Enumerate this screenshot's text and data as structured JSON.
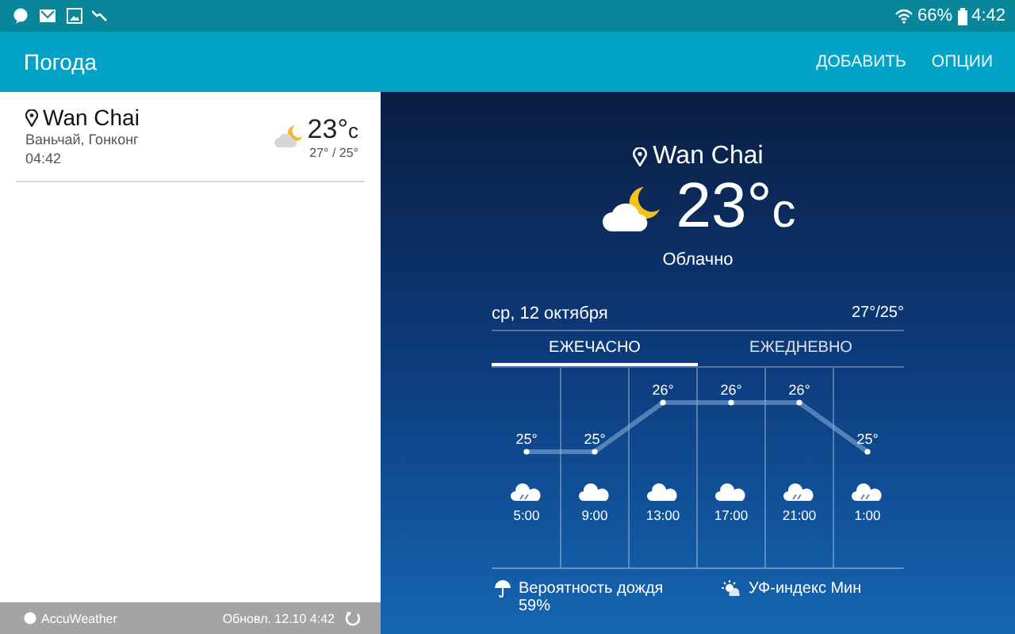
{
  "status_bar": {
    "battery": "66%",
    "time": "4:42"
  },
  "app_bar": {
    "title": "Погода",
    "actions": [
      "ДОБАВИТЬ",
      "ОПЦИИ"
    ]
  },
  "locations": [
    {
      "name": "Wan Chai",
      "subtitle": "Ваньчай, Гонконг",
      "time": "04:42",
      "temp": "23°",
      "unit": "c",
      "range": "27° / 25°",
      "selected": true
    }
  ],
  "footer": {
    "brand": "AccuWeather",
    "updated": "Обновл. 12.10 4:42"
  },
  "current": {
    "city": "Wan Chai",
    "temp": "23°",
    "unit": "c",
    "condition": "Облачно",
    "date": "ср, 12 октября",
    "range": "27°/25°"
  },
  "tabs": [
    {
      "label": "ЕЖЕЧАСНО",
      "selected": true
    },
    {
      "label": "ЕЖЕДНЕВНО",
      "selected": false
    }
  ],
  "hourly": {
    "chart_data": {
      "type": "line",
      "categories": [
        "5:00",
        "9:00",
        "13:00",
        "17:00",
        "21:00",
        "1:00"
      ],
      "series": [
        {
          "values": [
            25,
            25,
            26,
            26,
            26,
            25
          ],
          "marker": "circle",
          "value_labels": [
            "25°",
            "25°",
            "26°",
            "26°",
            "26°",
            "25°"
          ]
        }
      ]
    },
    "icons": [
      {
        "kind": "rain"
      },
      {
        "kind": "cloud"
      },
      {
        "kind": "cloud"
      },
      {
        "kind": "cloud"
      },
      {
        "kind": "rain"
      },
      {
        "kind": "rain"
      }
    ]
  },
  "details": [
    {
      "kind": "rain",
      "label": "Вероятность дождя",
      "value": "59%"
    },
    {
      "kind": "uv",
      "label": "УФ-индекс Мин"
    }
  ]
}
